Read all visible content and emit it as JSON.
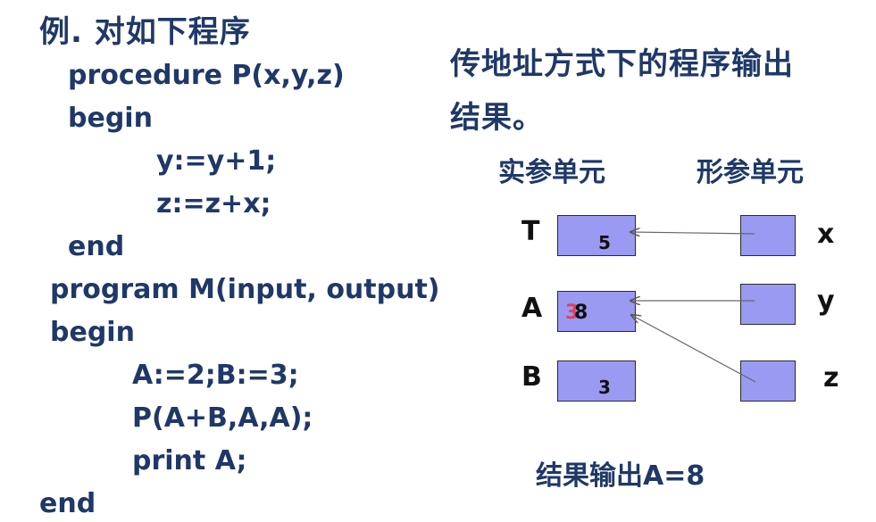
{
  "title": "例. 对如下程序",
  "code_lines": [
    "procedure P(x,y,z)",
    "begin",
    "y:=y+1;",
    "z:=z+x;",
    "end",
    "program M(input, output)",
    "begin",
    "A:=2;B:=3;",
    "P(A+B,A,A);",
    "print A;",
    "end"
  ],
  "heading_line1": "传地址方式下的程序输出",
  "heading_line2": "结果。",
  "actual_cells_header": "实参单元",
  "formal_cells_header": "形参单元",
  "actual_cells": [
    {
      "name": "T",
      "value": "5"
    },
    {
      "name": "A",
      "value_old": "3",
      "value": "8"
    },
    {
      "name": "B",
      "value": "3"
    }
  ],
  "formal_cells": [
    {
      "name": "x"
    },
    {
      "name": "y"
    },
    {
      "name": "z"
    }
  ],
  "result_text": "结果输出A=8",
  "colors": {
    "text": "#1f3868",
    "cell_fill": "#9a9af2",
    "overwritten_value": "#e0405a"
  }
}
